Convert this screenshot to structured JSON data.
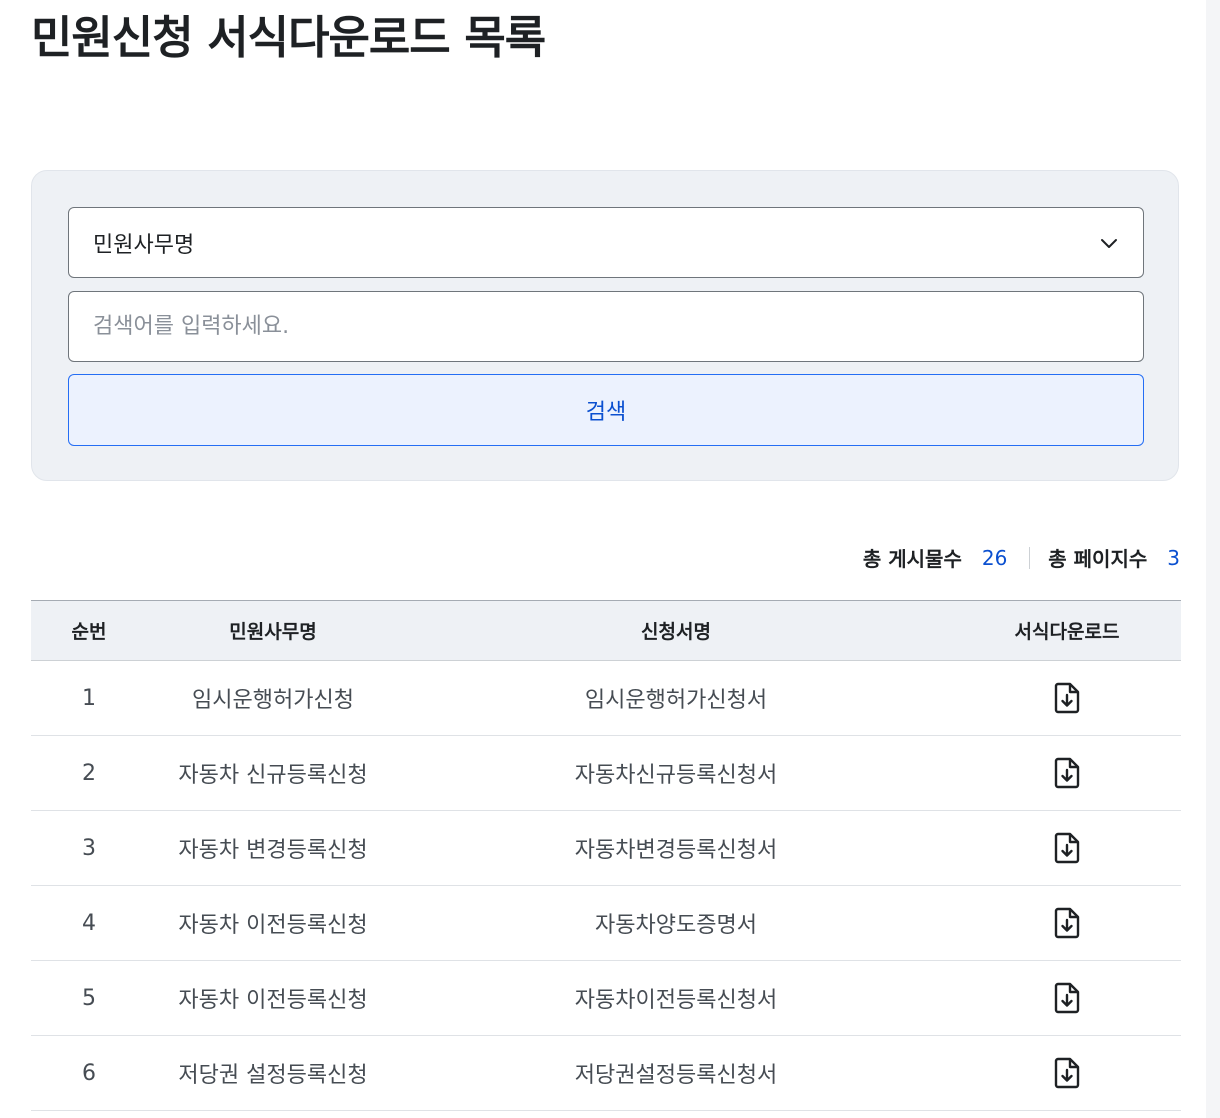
{
  "page": {
    "title": "민원신청 서식다운로드 목록"
  },
  "search": {
    "select_value": "민원사무명",
    "placeholder": "검색어를 입력하세요.",
    "button_label": "검색"
  },
  "summary": {
    "total_posts_label": "총 게시물수",
    "total_posts": "26",
    "total_pages_label": "총 페이지수",
    "total_pages": "3"
  },
  "table": {
    "headers": [
      "순번",
      "민원사무명",
      "신청서명",
      "서식다운로드"
    ],
    "rows": [
      {
        "no": "1",
        "service": "임시운행허가신청",
        "form": "임시운행허가신청서",
        "icon": "file-download-icon"
      },
      {
        "no": "2",
        "service": "자동차 신규등록신청",
        "form": "자동차신규등록신청서",
        "icon": "file-download-icon"
      },
      {
        "no": "3",
        "service": "자동차 변경등록신청",
        "form": "자동차변경등록신청서",
        "icon": "file-download-icon"
      },
      {
        "no": "4",
        "service": "자동차 이전등록신청",
        "form": "자동차양도증명서",
        "icon": "file-download-icon"
      },
      {
        "no": "5",
        "service": "자동차 이전등록신청",
        "form": "자동차이전등록신청서",
        "icon": "file-download-icon"
      },
      {
        "no": "6",
        "service": "저당권 설정등록신청",
        "form": "저당권설정등록신청서",
        "icon": "file-download-icon"
      }
    ]
  },
  "colors": {
    "accent": "#0b50d0",
    "panel_bg": "#eef1f5",
    "button_bg": "#ecf2fe"
  }
}
